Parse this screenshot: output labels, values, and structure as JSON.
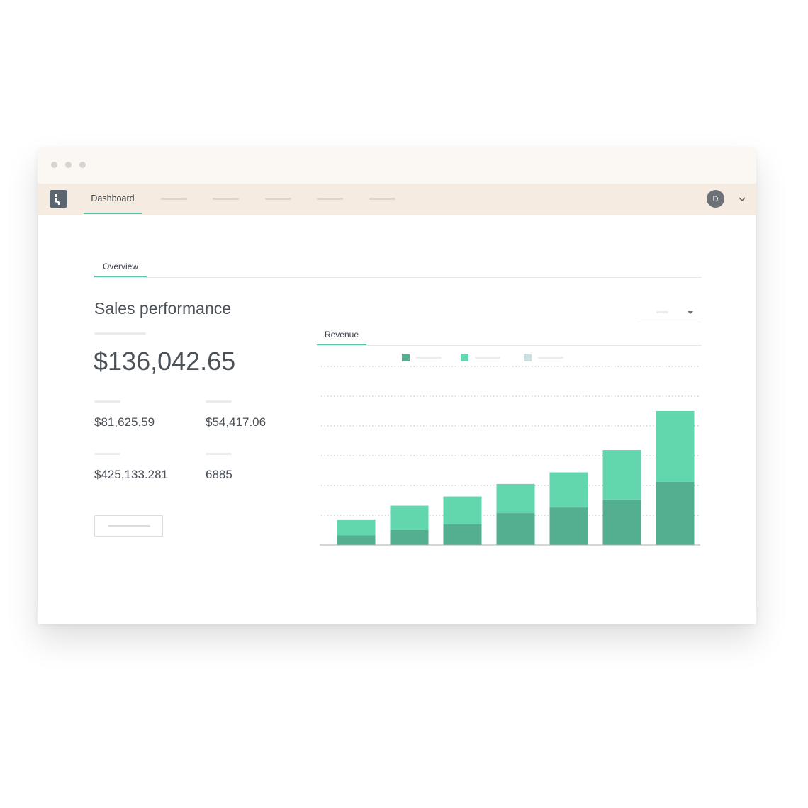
{
  "nav": {
    "active_tab": "Dashboard",
    "avatar_initial": "D"
  },
  "content": {
    "tab": "Overview",
    "heading": "Sales performance",
    "total": "$136,042.65",
    "stats": [
      {
        "value": "$81,625.59"
      },
      {
        "value": "$54,417.06"
      },
      {
        "value": "$425,133.281"
      },
      {
        "value": "6885"
      }
    ]
  },
  "colors": {
    "accent": "#5cc2b4",
    "series_dark": "#54ae90",
    "series_light": "#62d6ad",
    "series_pale": "#c9dfe0"
  },
  "chart_data": {
    "type": "bar",
    "stacked": true,
    "title": "Revenue",
    "categories": [
      "",
      "",
      "",
      "",
      "",
      "",
      ""
    ],
    "series": [
      {
        "values": [
          0.33,
          0.5,
          0.7,
          1.07,
          1.26,
          1.53,
          2.12
        ]
      },
      {
        "values": [
          0.53,
          0.82,
          0.93,
          0.98,
          1.18,
          1.66,
          2.38
        ]
      }
    ],
    "ylim": [
      0,
      6
    ],
    "grid": true,
    "legend": "top"
  }
}
